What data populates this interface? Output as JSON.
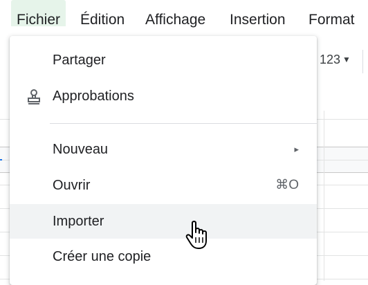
{
  "menubar": {
    "items": [
      {
        "label": "Fichier",
        "active": true
      },
      {
        "label": "Édition",
        "active": false
      },
      {
        "label": "Affichage",
        "active": false
      },
      {
        "label": "Insertion",
        "active": false
      },
      {
        "label": "Format",
        "active": false
      }
    ]
  },
  "toolbar": {
    "number_format_label": "123"
  },
  "file_menu": {
    "items": [
      {
        "label": "Partager",
        "icon": null
      },
      {
        "label": "Approbations",
        "icon": "stamp-icon"
      },
      {
        "label": "Nouveau",
        "submenu_arrow": "▸"
      },
      {
        "label": "Ouvrir",
        "shortcut": "⌘O"
      },
      {
        "label": "Importer",
        "hovered": true
      },
      {
        "label": "Créer une copie"
      }
    ]
  },
  "colors": {
    "active_menu_bg": "#e6f4ea",
    "hover_bg": "#f1f3f4",
    "selection_blue": "#1a73e8"
  }
}
